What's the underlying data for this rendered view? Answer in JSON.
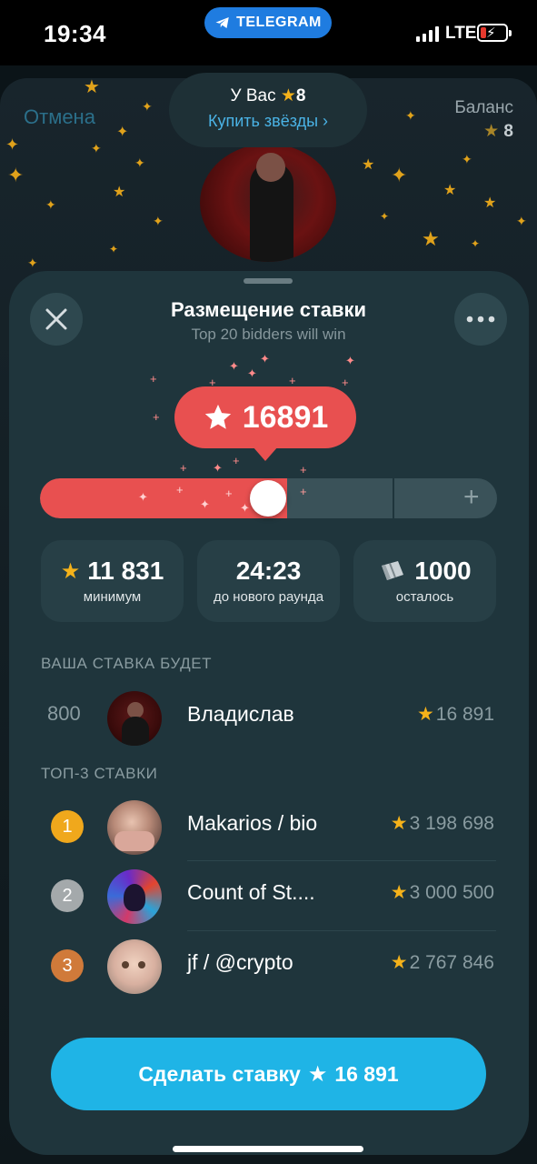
{
  "status_bar": {
    "time": "19:34",
    "app_pill": "TELEGRAM",
    "network": "LTE"
  },
  "background": {
    "cancel": "Отмена",
    "balance_label": "Баланс",
    "balance_value": "8"
  },
  "balance_popup": {
    "label": "У Вас",
    "value": "8",
    "buy_link": "Купить звёзды",
    "buy_chevron": "›"
  },
  "sheet": {
    "title": "Размещение ставки",
    "subtitle": "Top 20 bidders will win",
    "bid_value": "16891",
    "slider": {
      "fill_fraction": 0.5,
      "plus": "+"
    },
    "stats": [
      {
        "value": "11 831",
        "label": "минимум",
        "icon": "star-icon"
      },
      {
        "value": "24:23",
        "label": "до нового раунда"
      },
      {
        "value": "1000",
        "label": "осталось",
        "icon": "gift-icon"
      }
    ],
    "your_bid_section": "ВАША СТАВКА БУДЕТ",
    "your_bid": {
      "rank": "800",
      "name": "Владислав",
      "amount": "16 891"
    },
    "top_section": "ТОП-3 СТАВКИ",
    "top_bids": [
      {
        "rank": "1",
        "name": "Makarios / bio",
        "amount": "3 198 698",
        "medal_color": "#f0a81c"
      },
      {
        "rank": "2",
        "name": "Count of St....",
        "amount": "3 000 500",
        "medal_color": "#a4a9ab"
      },
      {
        "rank": "3",
        "name": "jf / @crypto",
        "amount": "2 767 846",
        "medal_color": "#d07a3a"
      }
    ],
    "cta_label": "Сделать ставку",
    "cta_amount": "16 891"
  },
  "colors": {
    "accent": "#1fb4e6",
    "bid_red": "#e85050",
    "star": "#f5b21a"
  }
}
